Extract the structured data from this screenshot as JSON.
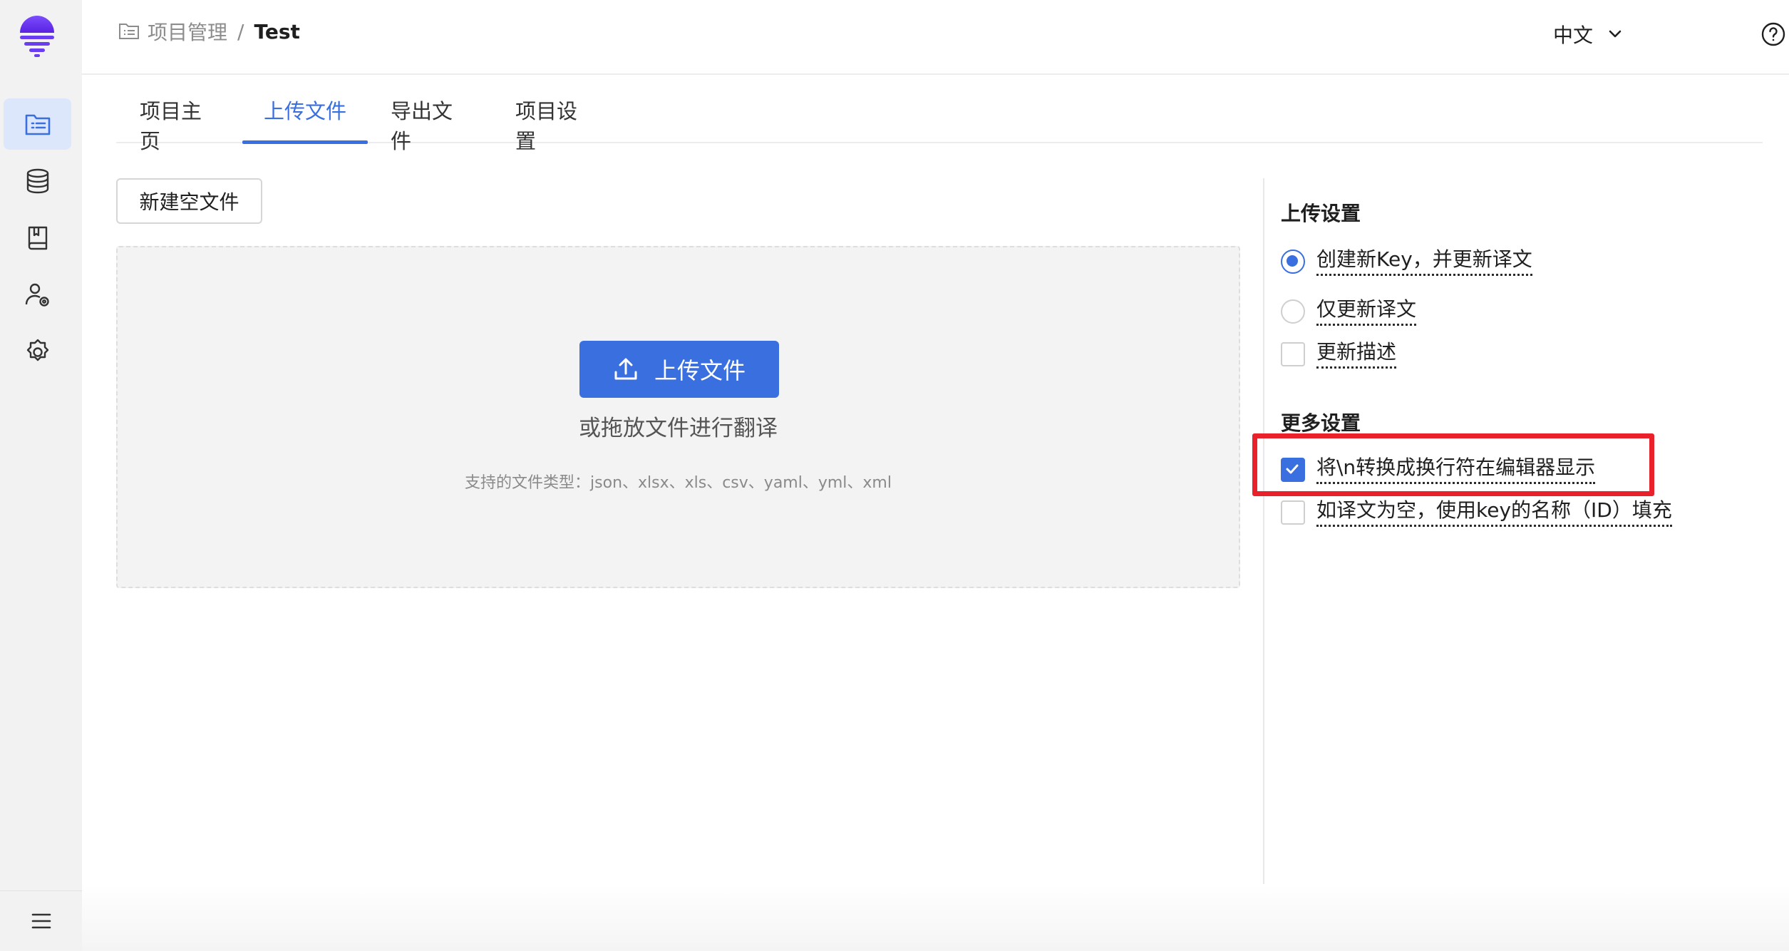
{
  "breadcrumb": {
    "parent": "项目管理",
    "separator": "/",
    "current": "Test"
  },
  "header": {
    "language": "中文"
  },
  "tabs": [
    {
      "label": "项目主页"
    },
    {
      "label": "上传文件"
    },
    {
      "label": "导出文件"
    },
    {
      "label": "项目设置"
    }
  ],
  "active_tab": "上传文件",
  "main": {
    "new_file_button": "新建空文件",
    "upload_button": "上传文件",
    "drop_hint": "或拖放文件进行翻译",
    "types_hint": "支持的文件类型：json、xlsx、xls、csv、yaml、yml、xml"
  },
  "upload_settings": {
    "title": "上传设置",
    "options": [
      {
        "label": "创建新Key，并更新译文",
        "type": "radio",
        "checked": true
      },
      {
        "label": "仅更新译文",
        "type": "radio",
        "checked": false
      },
      {
        "label": "更新描述",
        "type": "checkbox",
        "checked": false
      }
    ]
  },
  "more_settings": {
    "title": "更多设置",
    "options": [
      {
        "label": "将\\n转换成换行符在编辑器显示",
        "type": "checkbox",
        "checked": true,
        "highlighted": true
      },
      {
        "label": "如译文为空，使用key的名称（ID）填充",
        "type": "checkbox",
        "checked": false
      }
    ]
  },
  "icons": {
    "rail": [
      "logo-icon",
      "project-list-icon",
      "database-icon",
      "book-icon",
      "user-settings-icon",
      "gear-icon",
      "menu-icon"
    ],
    "header": [
      "folder-icon",
      "chevron-down-icon",
      "help-icon",
      "avatar"
    ]
  },
  "colors": {
    "accent": "#3a6fe0",
    "highlight_border": "#e8212b",
    "rail_bg": "#f2f2f3",
    "rail_active_bg": "#dde7fb",
    "logo_purple": "#6a3df0"
  }
}
